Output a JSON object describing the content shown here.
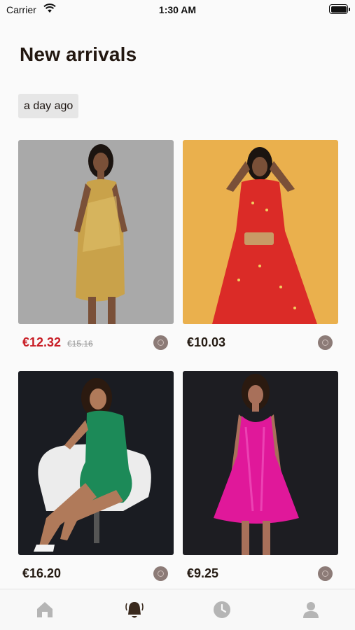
{
  "status_bar": {
    "carrier": "Carrier",
    "time": "1:30 AM"
  },
  "header": {
    "title": "New arrivals"
  },
  "section": {
    "time_label": "a day ago"
  },
  "products": [
    {
      "price": "€12.32",
      "old_price": "€15.16",
      "on_sale": true,
      "image": "gold sequin dress",
      "bg_color": "#a6a6a6"
    },
    {
      "price": "€10.03",
      "old_price": "",
      "on_sale": false,
      "image": "red floral belted dress",
      "bg_color": "#eab04d"
    },
    {
      "price": "€16.20",
      "old_price": "",
      "on_sale": false,
      "image": "green bodycon dress",
      "bg_color": "#1a1c22"
    },
    {
      "price": "€9.25",
      "old_price": "",
      "on_sale": false,
      "image": "pink satin dress",
      "bg_color": "#1d1d22"
    }
  ],
  "tab_bar": {
    "items": [
      {
        "icon": "home-icon",
        "active": false
      },
      {
        "icon": "bell-icon",
        "active": true
      },
      {
        "icon": "clock-icon",
        "active": false
      },
      {
        "icon": "person-icon",
        "active": false
      }
    ]
  },
  "colors": {
    "sale_price": "#c81d25",
    "active_tab": "#3a2a1e",
    "inactive_tab": "#b5b5b5"
  }
}
